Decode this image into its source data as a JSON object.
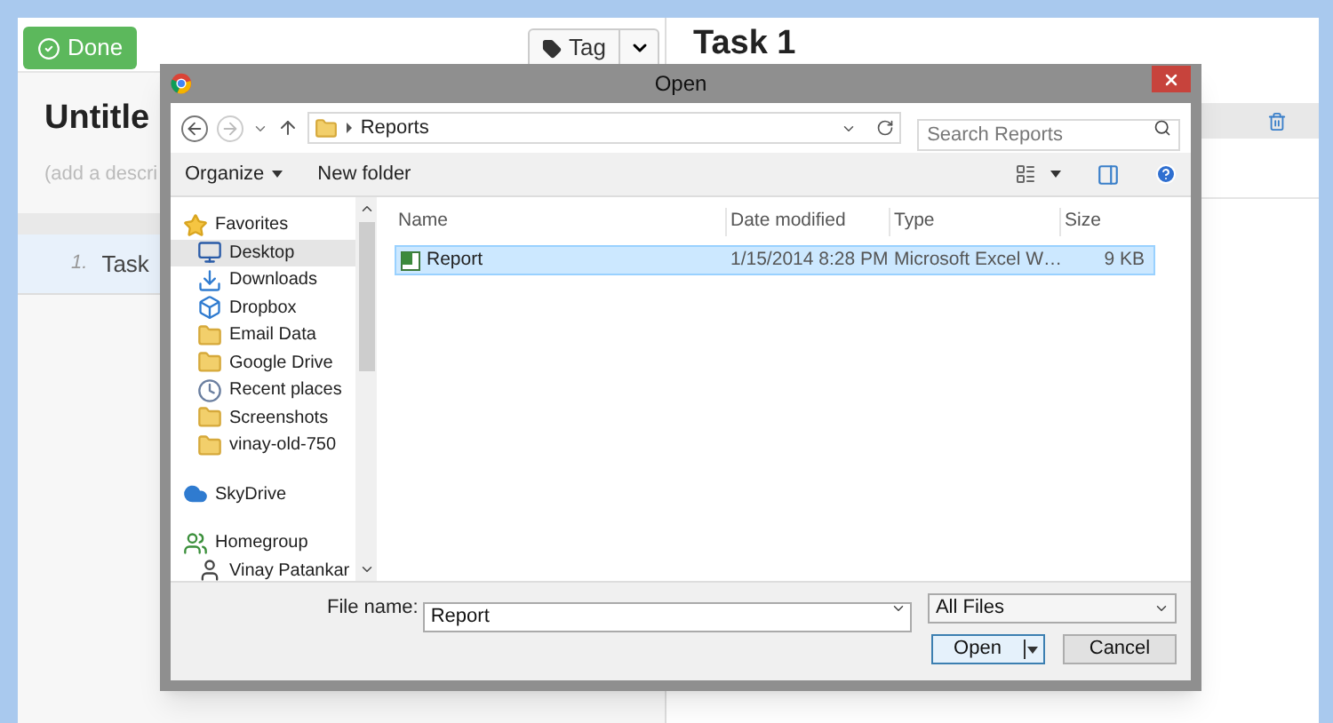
{
  "app": {
    "done_button": "Done",
    "tag_button": "Tag",
    "list_title": "Untitle",
    "description_placeholder": "(add a descri",
    "detail_title": "Task 1",
    "tasks": [
      {
        "number": "1.",
        "title": "Task",
        "selected": true
      }
    ]
  },
  "dialog": {
    "title": "Open",
    "path": [
      "Reports"
    ],
    "search_placeholder": "Search Reports",
    "toolbar": [
      "Organize",
      "New folder"
    ],
    "nav": [
      {
        "label": "Favorites",
        "kind": "favorites",
        "selected": false,
        "children": [
          {
            "label": "Desktop",
            "kind": "desktop",
            "selected": true
          },
          {
            "label": "Downloads",
            "kind": "downloads",
            "selected": false
          },
          {
            "label": "Dropbox",
            "kind": "dropbox",
            "selected": false
          },
          {
            "label": "Email Data",
            "kind": "folder",
            "selected": false
          },
          {
            "label": "Google Drive",
            "kind": "folder",
            "selected": false
          },
          {
            "label": "Recent places",
            "kind": "recent",
            "selected": false
          },
          {
            "label": "Screenshots",
            "kind": "folder",
            "selected": false
          },
          {
            "label": "vinay-old-750",
            "kind": "folder",
            "selected": false
          }
        ]
      },
      {
        "label": "SkyDrive",
        "kind": "cloud",
        "selected": false
      },
      {
        "label": "Homegroup",
        "kind": "homegroup",
        "selected": false,
        "children": [
          {
            "label": "Vinay Patankar",
            "kind": "user",
            "selected": false
          }
        ]
      }
    ],
    "columns": [
      "Name",
      "Date modified",
      "Type",
      "Size"
    ],
    "files": [
      {
        "name": "Report",
        "date": "1/15/2014 8:28 PM",
        "type": "Microsoft Excel W…",
        "size": "9 KB",
        "selected": true
      }
    ],
    "file_name_label": "File name:",
    "file_name": "Report",
    "filter": "All Files",
    "buttons": [
      "Open",
      "Cancel"
    ]
  }
}
